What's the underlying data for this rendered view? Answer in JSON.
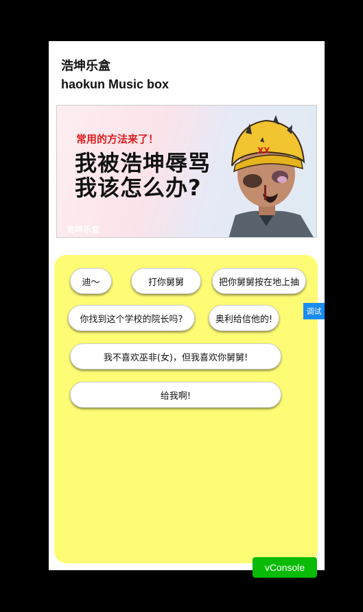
{
  "header": {
    "title": "浩坤乐盒",
    "subtitle": "haokun Music box"
  },
  "banner": {
    "tag": "常用的方法来了！",
    "headline": "我被浩坤辱骂我该怎么办?",
    "watermark": "浩坤乐盒",
    "helmet_text": "XX"
  },
  "panel": {
    "background": "#fefc75",
    "buttons": [
      {
        "label": "迪～"
      },
      {
        "label": "打你舅舅"
      },
      {
        "label": "把你舅舅按在地上抽"
      },
      {
        "label": "你找到这个学校的院长吗?"
      },
      {
        "label": "奥利给信他的!"
      },
      {
        "label": "我不喜欢巫非(女)，但我喜欢你舅舅!"
      },
      {
        "label": "给我啊!"
      }
    ]
  },
  "debug": {
    "tab_label": "调试",
    "vconsole_label": "vConsole"
  }
}
